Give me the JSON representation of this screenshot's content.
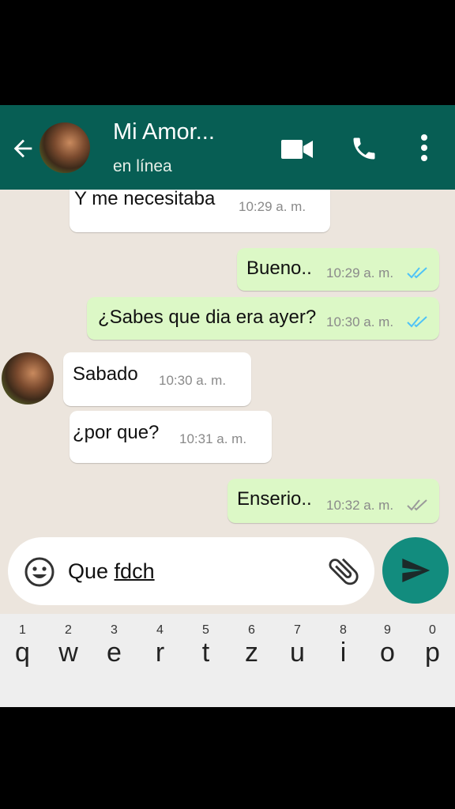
{
  "header": {
    "title": "Mi Amor...",
    "status": "en línea",
    "back_icon": "arrow-left",
    "video_icon": "videocam",
    "call_icon": "phone",
    "menu_icon": "more-vert",
    "bar_color": "#075e54"
  },
  "messages": [
    {
      "direction": "in",
      "text": "Y me necesitaba",
      "time": "10:29 a. m."
    },
    {
      "direction": "out",
      "text": "Bueno..",
      "time": "10:29 a. m.",
      "status": "read"
    },
    {
      "direction": "out",
      "text": "¿Sabes que dia era ayer?",
      "time": "10:30 a. m.",
      "status": "read"
    },
    {
      "direction": "in",
      "text": "Sabado",
      "time": "10:30 a. m."
    },
    {
      "direction": "in",
      "text": "¿por que?",
      "time": "10:31 a. m."
    },
    {
      "direction": "out",
      "text": "Enserio..",
      "time": "10:32 a. m.",
      "status": "delivered"
    }
  ],
  "composer": {
    "value_prefix": "Que ",
    "value_underlined": "fdch",
    "emoji_icon": "emoji",
    "attach_icon": "paperclip",
    "send_icon": "send",
    "send_color": "#128c7e"
  },
  "keyboard": {
    "numbers": [
      "1",
      "2",
      "3",
      "4",
      "5",
      "6",
      "7",
      "8",
      "9",
      "0"
    ],
    "letters": [
      "q",
      "w",
      "e",
      "r",
      "t",
      "z",
      "u",
      "i",
      "o",
      "p"
    ]
  },
  "colors": {
    "outgoing_bubble": "#dcf8c6",
    "incoming_bubble": "#ffffff",
    "read_ticks": "#4fc3f7",
    "chat_bg": "#ece5dd"
  }
}
